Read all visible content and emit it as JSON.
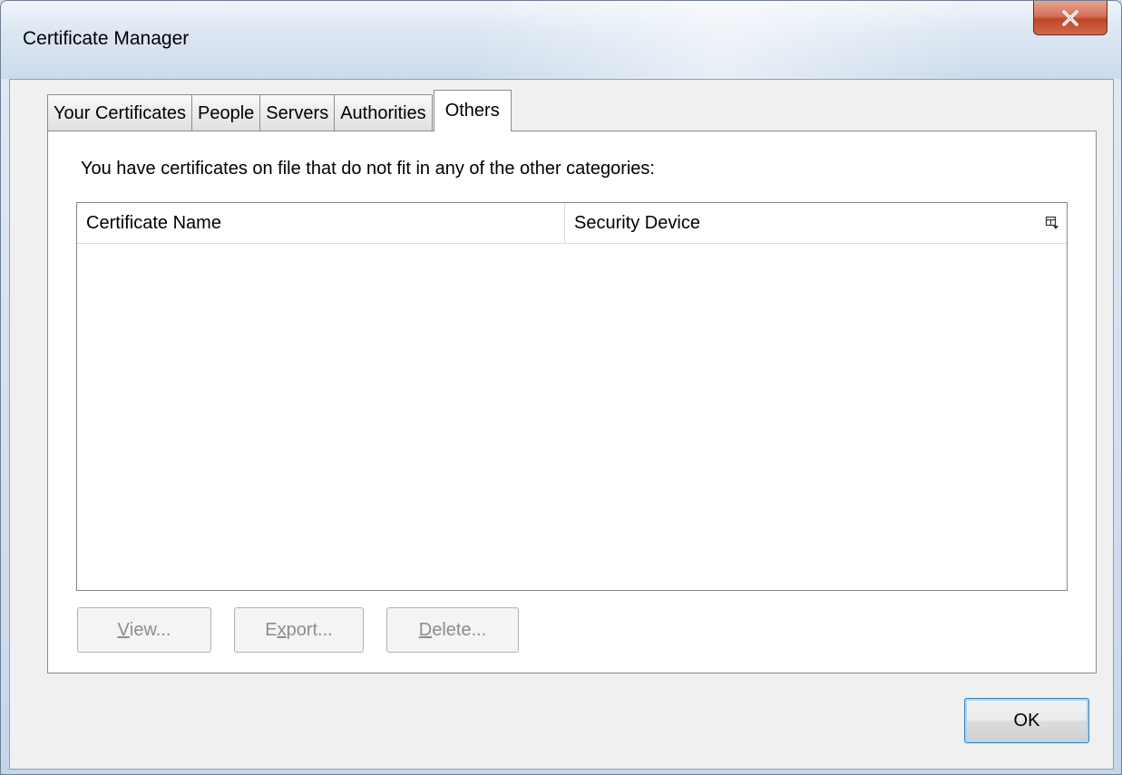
{
  "window": {
    "title": "Certificate Manager",
    "close_label": "x"
  },
  "tabs": [
    {
      "label": "Your Certificates",
      "active": false
    },
    {
      "label": "People",
      "active": false
    },
    {
      "label": "Servers",
      "active": false
    },
    {
      "label": "Authorities",
      "active": false
    },
    {
      "label": "Others",
      "active": true
    }
  ],
  "panel": {
    "description": "You have certificates on file that do not fit in any of the other categories:",
    "columns": [
      "Certificate Name",
      "Security Device"
    ],
    "column_picker_icon": "column-picker-icon",
    "rows": []
  },
  "actions": {
    "view": {
      "prefix": "",
      "accel": "V",
      "suffix": "iew...",
      "enabled": false
    },
    "export": {
      "prefix": "E",
      "accel": "x",
      "suffix": "port...",
      "enabled": false
    },
    "delete": {
      "prefix": "",
      "accel": "D",
      "suffix": "elete...",
      "enabled": false
    }
  },
  "footer": {
    "ok_label": "OK"
  },
  "colors": {
    "disabled_text": "#8d8d8d",
    "close_button": "#c2452a",
    "default_button_border": "#3c7fb1"
  }
}
